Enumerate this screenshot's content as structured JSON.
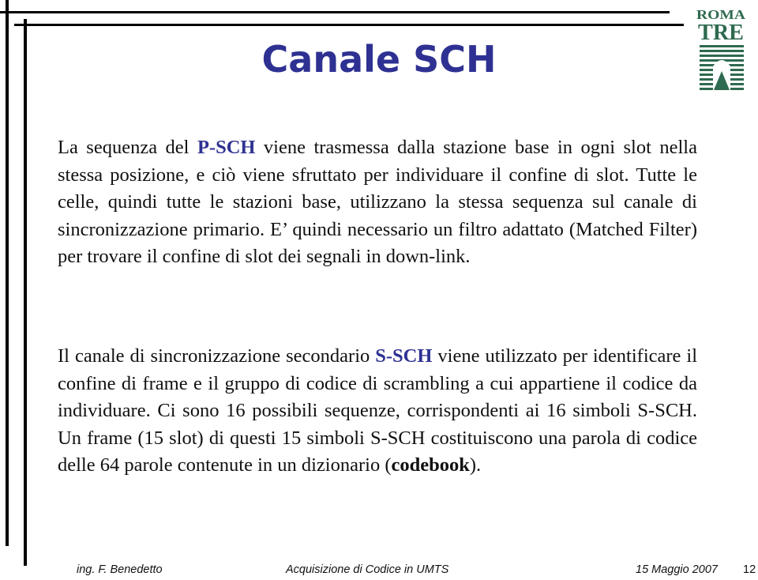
{
  "slide": {
    "title": "Canale SCH",
    "logo": {
      "line1": "ROMA",
      "line2": "TRE",
      "color": "#2e6a4f"
    },
    "accent_color": "#2e3192",
    "paragraph1": {
      "before": "La sequenza del ",
      "highlight": "P-SCH",
      "after": " viene trasmessa dalla stazione base in ogni slot nella stessa posizione, e ciò viene sfruttato per individuare il confine di slot. Tutte le celle, quindi tutte le stazioni base, utilizzano la stessa sequenza sul canale di sincronizzazione primario. E’ quindi necessario un filtro adattato (Matched Filter) per trovare il confine di slot dei segnali in down-link."
    },
    "paragraph2": {
      "before": "Il canale di sincronizzazione secondario ",
      "highlight": "S-SCH",
      "middle": " viene utilizzato per identificare il confine di frame e il gruppo di codice di scrambling a cui appartiene il codice da individuare. Ci sono 16 possibili sequenze, corrispondenti ai 16 simboli S-SCH. Un frame (15 slot) di questi 15 simboli S-SCH costituiscono una parola di codice delle 64 parole contenute in un dizionario (",
      "bold": "codebook",
      "after": ")."
    }
  },
  "footer": {
    "author": "ing. F. Benedetto",
    "course": "Acquisizione di Codice in UMTS",
    "date": "15 Maggio 2007",
    "page": "12"
  }
}
